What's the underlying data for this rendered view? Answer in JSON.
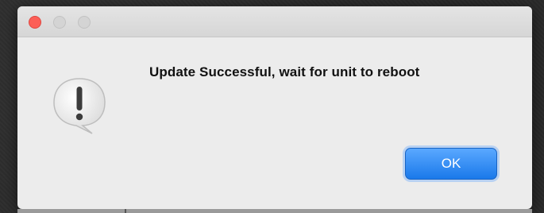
{
  "dialog": {
    "message": "Update Successful, wait for unit to reboot",
    "ok_label": "OK",
    "icon": "alert-exclamation-icon",
    "accent_color": "#1a79ea"
  }
}
